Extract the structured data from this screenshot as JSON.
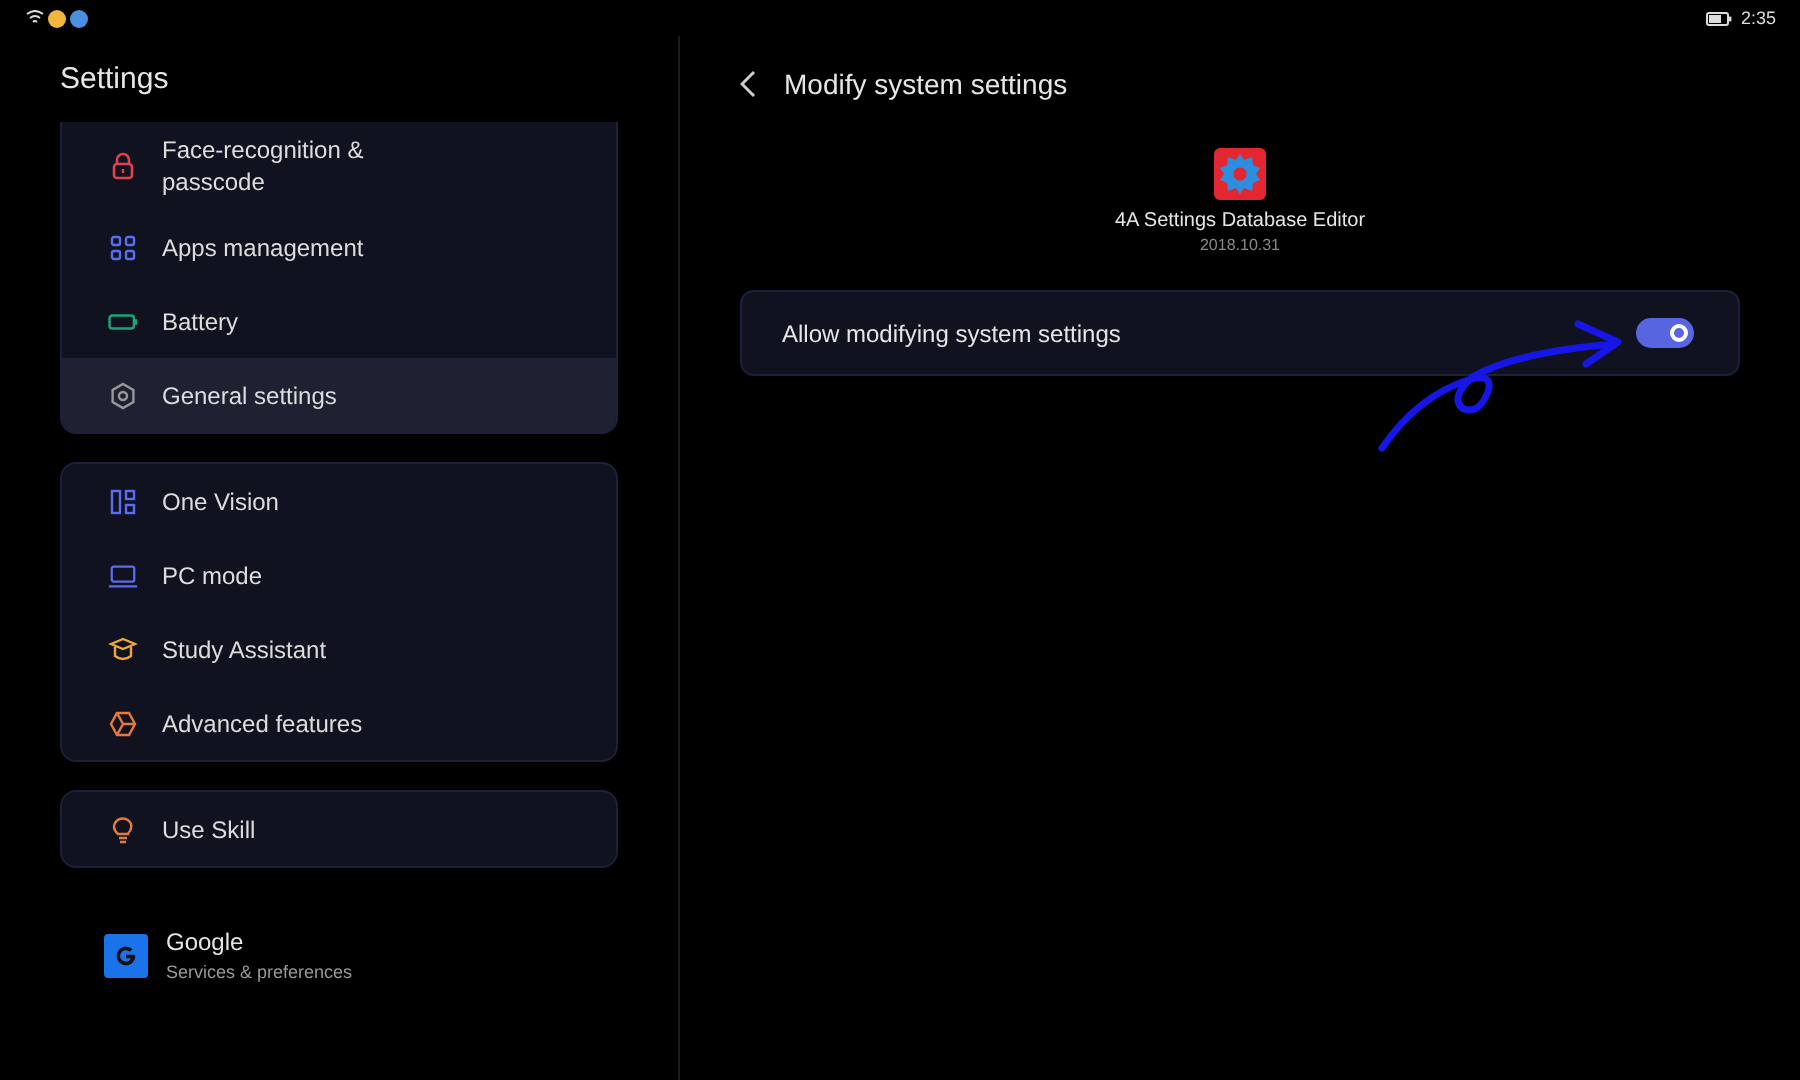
{
  "status_bar": {
    "time": "2:35"
  },
  "sidebar": {
    "title": "Settings",
    "groups": [
      {
        "items": [
          {
            "label": "Face-recognition &\npasscode",
            "selected": false
          },
          {
            "label": "Apps management",
            "selected": false
          },
          {
            "label": "Battery",
            "selected": false
          },
          {
            "label": "General settings",
            "selected": true
          }
        ]
      },
      {
        "items": [
          {
            "label": "One Vision",
            "selected": false
          },
          {
            "label": "PC mode",
            "selected": false
          },
          {
            "label": "Study Assistant",
            "selected": false
          },
          {
            "label": "Advanced features",
            "selected": false
          }
        ]
      },
      {
        "items": [
          {
            "label": "Use Skill",
            "selected": false
          }
        ]
      }
    ],
    "account": {
      "title": "Google",
      "subtitle": "Services & preferences"
    }
  },
  "page": {
    "title": "Modify system settings",
    "app": {
      "name": "4A Settings Database Editor",
      "version": "2018.10.31"
    },
    "setting": {
      "label": "Allow modifying system settings",
      "on": true
    }
  }
}
